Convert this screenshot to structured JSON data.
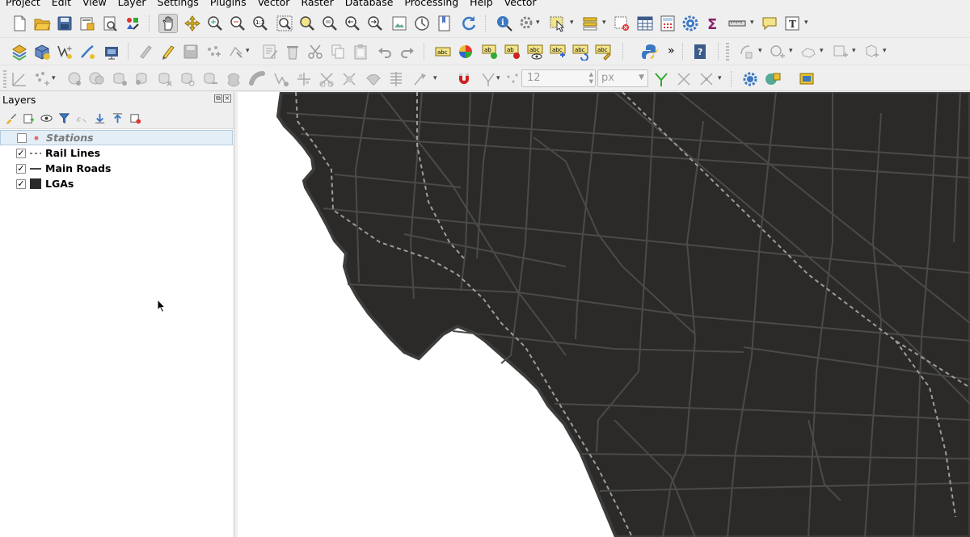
{
  "menu": {
    "items": [
      "Project",
      "Edit",
      "View",
      "Layer",
      "Settings",
      "Plugins",
      "Vector",
      "Raster",
      "Database",
      "Processing",
      "Help",
      "Vector"
    ]
  },
  "toolbar3": {
    "symbol_size_value": "12",
    "symbol_size_unit": "px"
  },
  "layers_panel": {
    "title": "Layers",
    "layers": [
      {
        "name": "Stations",
        "checked": false,
        "symbol": "point",
        "selected": true
      },
      {
        "name": "Rail Lines",
        "checked": true,
        "symbol": "dashed-line",
        "selected": false
      },
      {
        "name": "Main Roads",
        "checked": true,
        "symbol": "line",
        "selected": false
      },
      {
        "name": "LGAs",
        "checked": true,
        "symbol": "fill",
        "selected": false
      }
    ]
  },
  "map": {
    "land_color": "#2b2a28",
    "background_color": "#ffffff",
    "road_color": "#4a4a48",
    "coast_outline_color": "#3d3c3a",
    "rail_color": "#9c9c9c"
  },
  "colors": {
    "panel_bg": "#efefef",
    "selection_bg": "#e3eef7",
    "station_symbol": "#e07070"
  }
}
